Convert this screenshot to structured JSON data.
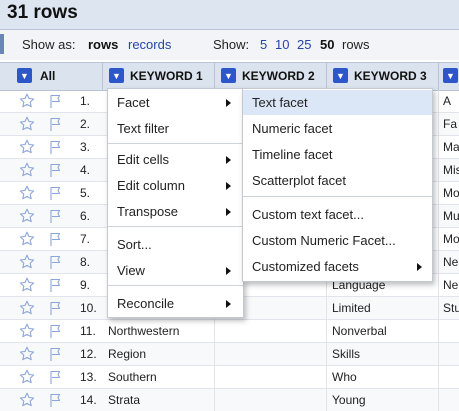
{
  "title": "31 rows",
  "view_bar": {
    "show_as_label": "Show as:",
    "mode_rows": "rows",
    "mode_records": "records",
    "show_label": "Show:",
    "page_sizes": [
      "5",
      "10",
      "25",
      "50"
    ],
    "page_size_selected": "50",
    "page_size_suffix": "rows"
  },
  "columns": [
    "All",
    "KEYWORD 1",
    "KEYWORD 2",
    "KEYWORD 3"
  ],
  "rows": [
    {
      "n": "1.",
      "k1": "",
      "k2": "",
      "k3": "",
      "k4": "A"
    },
    {
      "n": "2.",
      "k1": "",
      "k2": "",
      "k3": "",
      "k4": "Fa"
    },
    {
      "n": "3.",
      "k1": "",
      "k2": "",
      "k3": "",
      "k4": "Ma"
    },
    {
      "n": "4.",
      "k1": "",
      "k2": "",
      "k3": "",
      "k4": "Mis"
    },
    {
      "n": "5.",
      "k1": "",
      "k2": "",
      "k3": "",
      "k4": "Mo"
    },
    {
      "n": "6.",
      "k1": "",
      "k2": "",
      "k3": "",
      "k4": "Mu"
    },
    {
      "n": "7.",
      "k1": "",
      "k2": "",
      "k3": "",
      "k4": "Mo"
    },
    {
      "n": "8.",
      "k1": "",
      "k2": "",
      "k3": "",
      "k4": "Ne"
    },
    {
      "n": "9.",
      "k1": "",
      "k2": "",
      "k3": "Language",
      "k4": "Ne"
    },
    {
      "n": "10.",
      "k1": "",
      "k2": "",
      "k3": "Limited",
      "k4": "Stu"
    },
    {
      "n": "11.",
      "k1": "Northwestern",
      "k2": "",
      "k3": "Nonverbal",
      "k4": ""
    },
    {
      "n": "12.",
      "k1": "Region",
      "k2": "",
      "k3": "Skills",
      "k4": ""
    },
    {
      "n": "13.",
      "k1": "Southern",
      "k2": "",
      "k3": "Who",
      "k4": ""
    },
    {
      "n": "14.",
      "k1": "Strata",
      "k2": "",
      "k3": "Young",
      "k4": ""
    }
  ],
  "column_menu": {
    "items": [
      "Facet",
      "Text filter",
      "Edit cells",
      "Edit column",
      "Transpose",
      "Sort...",
      "View",
      "Reconcile"
    ]
  },
  "facet_submenu": {
    "items": [
      "Text facet",
      "Numeric facet",
      "Timeline facet",
      "Scatterplot facet",
      "Custom text facet...",
      "Custom Numeric Facet...",
      "Customized facets"
    ],
    "highlighted": "Text facet"
  }
}
